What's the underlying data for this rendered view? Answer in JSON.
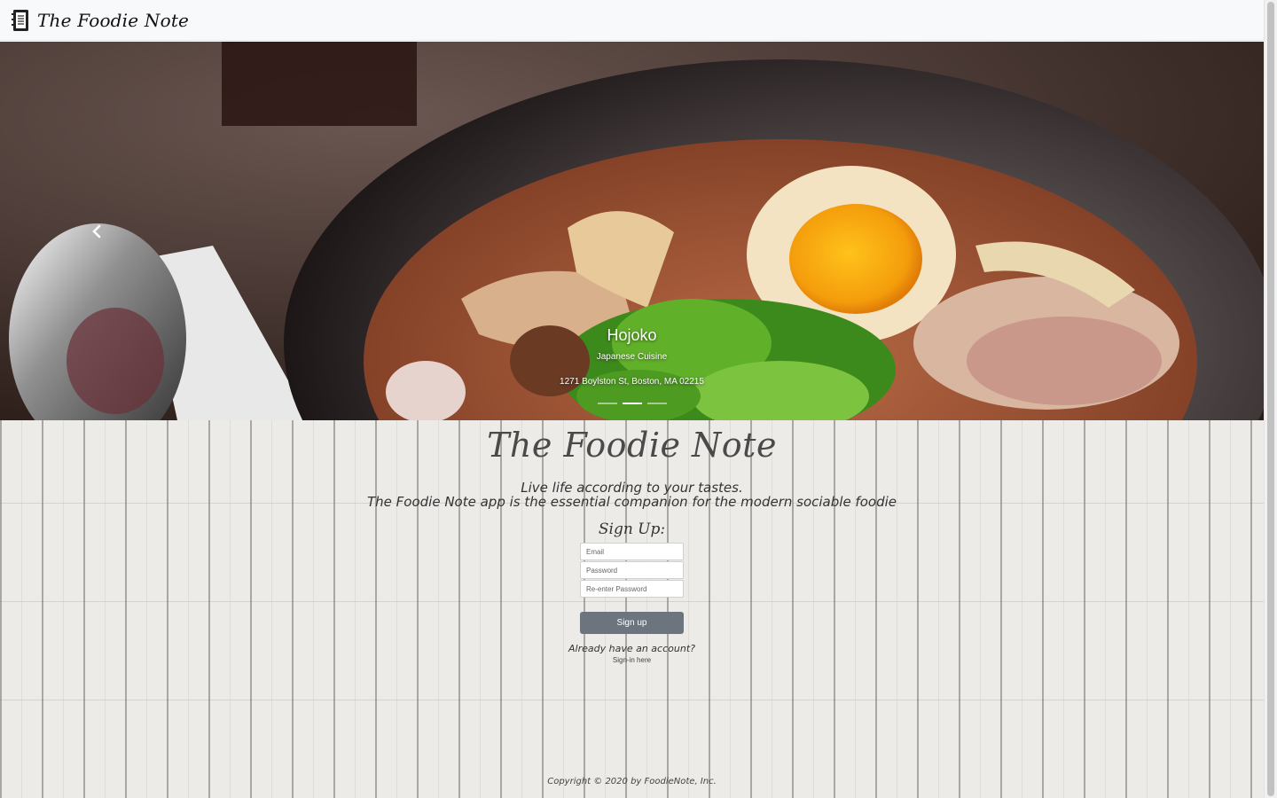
{
  "navbar": {
    "brand": "The Foodie Note",
    "brand_icon": "notebook-icon"
  },
  "carousel": {
    "prev_icon": "chevron-left-icon",
    "caption": {
      "title": "Hojoko",
      "cuisine": "Japanese Cuisine",
      "address": "1271 Boylston St, Boston, MA 02215"
    },
    "indicators": 3,
    "active_index": 1
  },
  "main": {
    "title": "The Foodie Note",
    "tagline_line1": "Live life according to your tastes.",
    "tagline_line2": "The Foodie Note app is the essential companion for the modern sociable foodie",
    "signup_label": "Sign Up:",
    "form": {
      "email_placeholder": "Email",
      "password_placeholder": "Password",
      "reenter_placeholder": "Re-enter Password",
      "submit_label": "Sign up"
    },
    "already_text": "Already have an account?",
    "signin_link": "Sign-in here"
  },
  "footer": {
    "copyright": "Copyright © 2020 by FoodieNote, Inc."
  },
  "colors": {
    "navbar_bg": "#f8f9fa",
    "button_bg": "#6c757d",
    "wood_bg": "#ecebe8"
  }
}
